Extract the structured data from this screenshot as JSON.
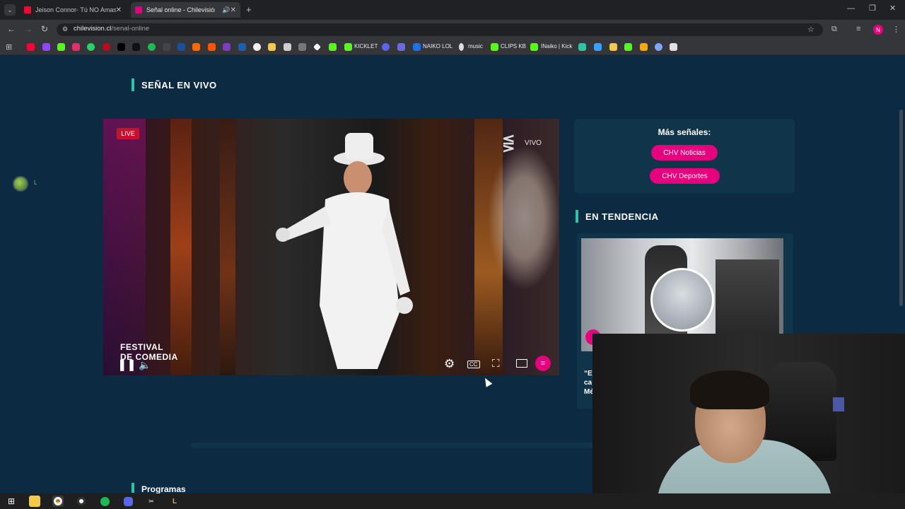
{
  "browser": {
    "tabs": [
      {
        "title": "Jeison Connor- Tú NO Amas (I",
        "favicon_color": "#ff0033",
        "active": false
      },
      {
        "title": "Señal online - Chilevisión",
        "favicon_color": "#e6007e",
        "active": true
      }
    ],
    "url_domain": "chilevision.cl",
    "url_path": "/senal-online",
    "bookmarks": [
      {
        "label": "KICKLET",
        "color": "#53fc18"
      },
      {
        "label": "NAIKO LOL",
        "color": "#1a73e8"
      },
      {
        "label": "music",
        "color": "#dddddd"
      },
      {
        "label": "CLIPS KB",
        "color": "#53fc18"
      },
      {
        "label": "INaiko | Kick",
        "color": "#53fc18"
      }
    ],
    "profile_initial": "N"
  },
  "page": {
    "section_title": "SEÑAL EN VIVO",
    "trend_title": "EN TENDENCIA",
    "programs_title": "Programas",
    "float_label": "L"
  },
  "player": {
    "live_badge": "LIVE",
    "vivo_label": "VIVO",
    "festival_logo_line1": "FESTIVAL",
    "festival_logo_line2": "DE COMEDIA",
    "controls": {
      "cc_label": "CC"
    }
  },
  "sidebar": {
    "signals_title": "Más señales:",
    "buttons": [
      "CHV Noticias",
      "CHV Deportes"
    ],
    "trend_snippet": "“Ev ca Mé"
  },
  "colors": {
    "accent": "#2ec4a5",
    "brand_pink": "#e6007e",
    "page_bg": "#0c2a42",
    "live_red": "#c8102e"
  }
}
